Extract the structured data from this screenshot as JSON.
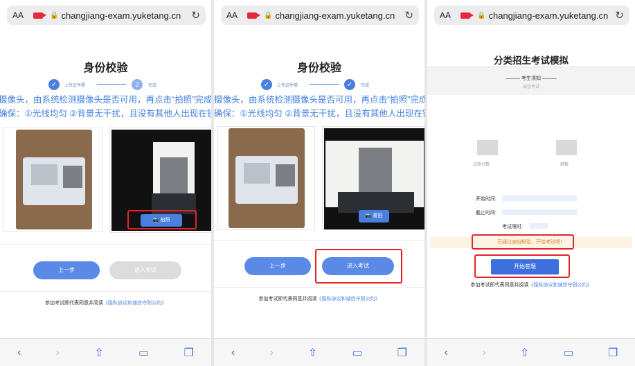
{
  "browser": {
    "aa": "AA",
    "url": "changjiang-exam.yuketang.cn",
    "reload": "↻"
  },
  "verify": {
    "title": "身份校验",
    "step1_label": "上传证件照",
    "step2_label": "完成",
    "step2_num": "2",
    "notice_line1": "摄像头，由系统检测摄像头是否可用，再点击“拍照”完成身份",
    "notice_line2": "确保：①光线均匀 ②背景无干扰，且没有其他人出现在镜头",
    "take_photo": "拍照",
    "retake_photo": "重拍",
    "prev_button": "上一步",
    "enter_button": "进入考试",
    "agree_text": "参加考试即代表同意并阅读",
    "agree_link": "《隐私协议和诚信守则公约》"
  },
  "exam": {
    "title": "分类招生考试模拟",
    "notice_heading": "——— 考生须知 ———",
    "notice_sub": "诚信考试",
    "score_label": "试卷分数",
    "count_label": "题数",
    "start_time": "开始时间:",
    "end_time": "截止时间:",
    "time_limit": "考试限时:",
    "passed_msg": "已通过身份校验，开始考试吧！",
    "start_button": "开始答题",
    "agree_text": "参加考试即代表同意并阅读",
    "agree_link": "《隐私协议和诚信守则公约》"
  },
  "toolbar": {
    "back": "‹",
    "forward": "›",
    "share": "⇧",
    "bookmarks": "▭",
    "tabs": "❐"
  },
  "colors": {
    "accent": "#4a7fe0",
    "highlight": "#e3222a",
    "warning": "#e0852a"
  }
}
